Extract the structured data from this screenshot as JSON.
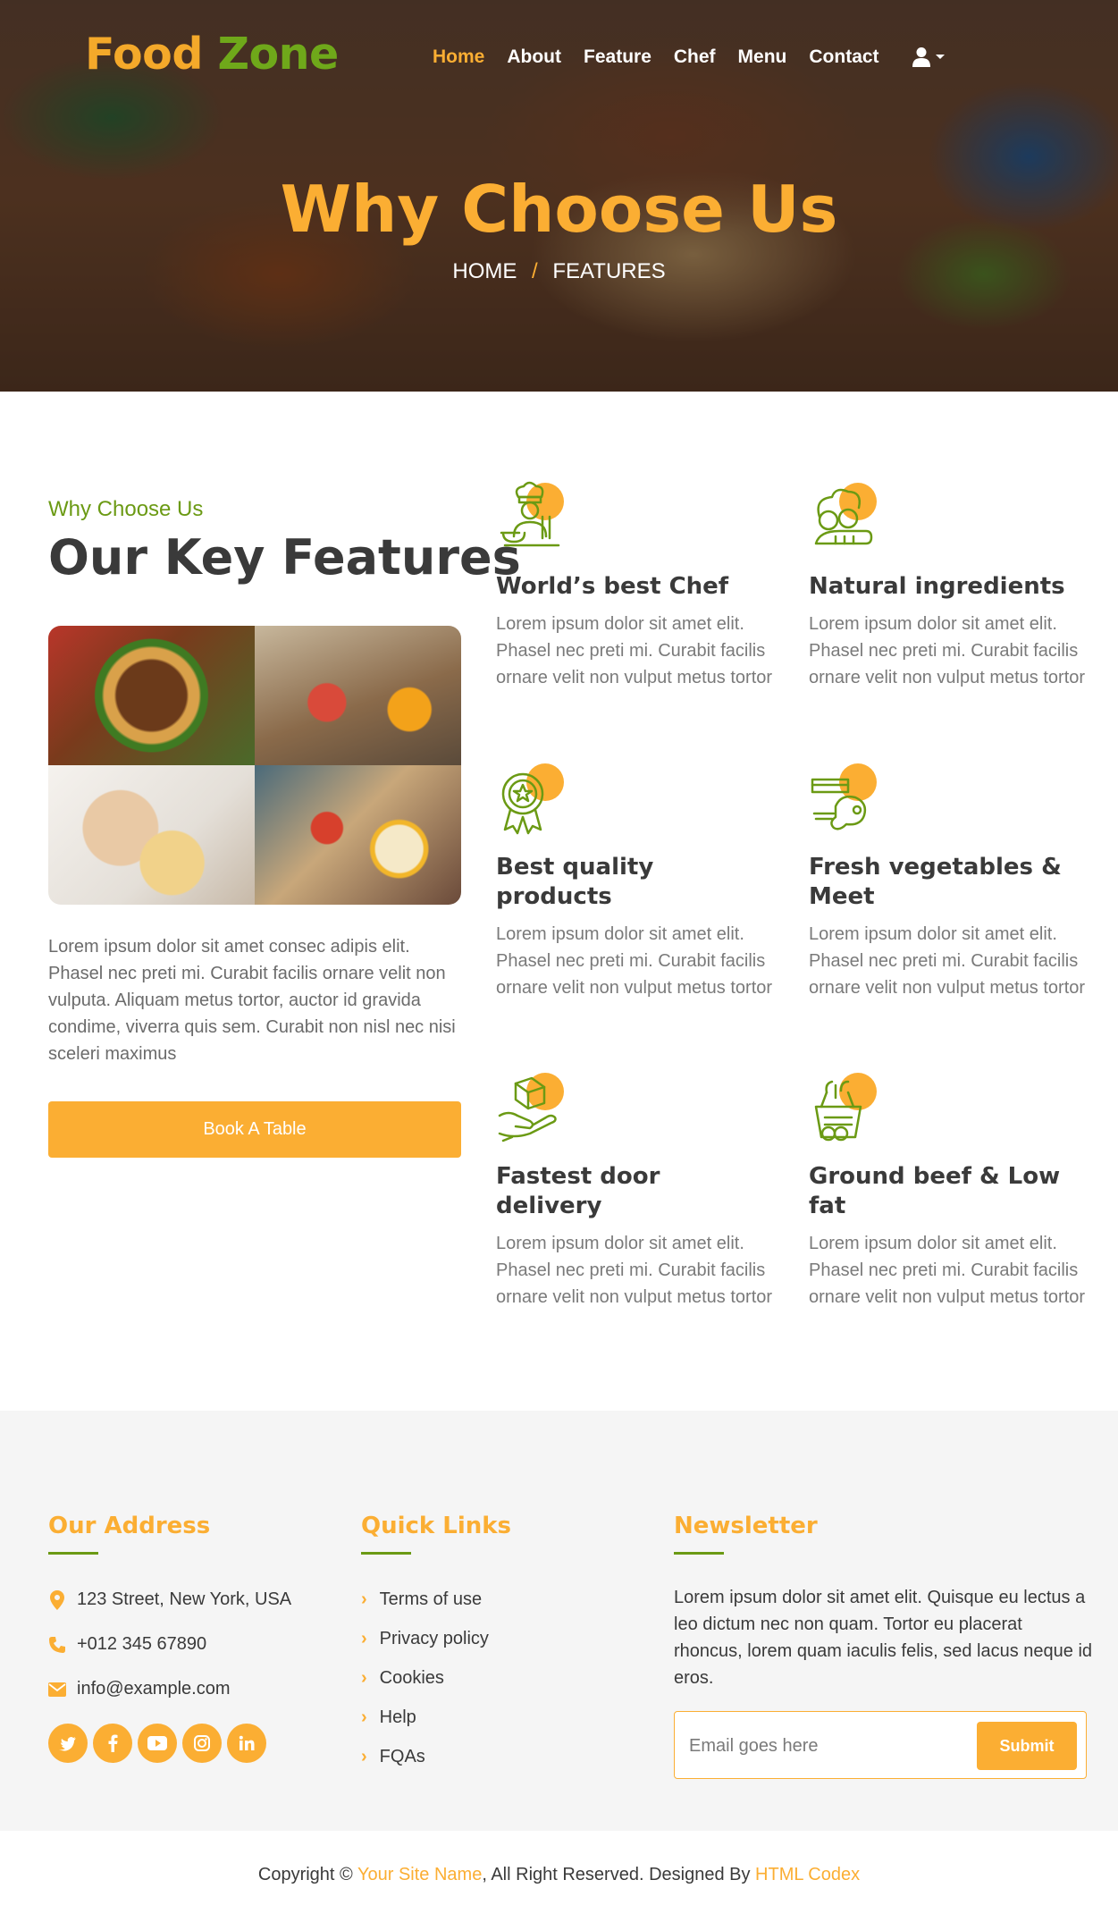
{
  "brand": {
    "part1": "Food",
    "part2": "Zone"
  },
  "nav": {
    "items": [
      {
        "label": "Home",
        "active": true
      },
      {
        "label": "About"
      },
      {
        "label": "Feature"
      },
      {
        "label": "Chef"
      },
      {
        "label": "Menu"
      },
      {
        "label": "Contact"
      }
    ],
    "user_icon": "user-icon"
  },
  "hero": {
    "title": "Why Choose Us",
    "breadcrumb": [
      "HOME",
      "FEATURES"
    ],
    "separator": "/"
  },
  "features": {
    "subtitle": "Why Choose Us",
    "title": "Our Key Features",
    "intro": "Lorem ipsum dolor sit amet consec adipis elit. Phasel nec preti mi. Curabit facilis ornare velit non vulputa. Aliquam metus tortor, auctor id gravida condime, viverra quis sem. Curabit non nisl nec nisi sceleri maximus",
    "button": "Book A Table",
    "items": [
      {
        "title": "World’s best Chef",
        "text": "Lorem ipsum dolor sit amet elit. Phasel nec preti mi. Curabit facilis ornare velit non vulput metus tortor",
        "icon": "chef-icon"
      },
      {
        "title": "Natural ingredients",
        "text": "Lorem ipsum dolor sit amet elit. Phasel nec preti mi. Curabit facilis ornare velit non vulput metus tortor",
        "icon": "vegetables-icon"
      },
      {
        "title": "Best quality products",
        "text": "Lorem ipsum dolor sit amet elit. Phasel nec preti mi. Curabit facilis ornare velit non vulput metus tortor",
        "icon": "quality-badge-icon"
      },
      {
        "title": "Fresh vegetables & Meet",
        "text": "Lorem ipsum dolor sit amet elit. Phasel nec preti mi. Curabit facilis ornare velit non vulput metus tortor",
        "icon": "meat-icon"
      },
      {
        "title": "Fastest door delivery",
        "text": "Lorem ipsum dolor sit amet elit. Phasel nec preti mi. Curabit facilis ornare velit non vulput metus tortor",
        "icon": "delivery-icon"
      },
      {
        "title": "Ground beef & Low fat",
        "text": "Lorem ipsum dolor sit amet elit. Phasel nec preti mi. Curabit facilis ornare velit non vulput metus tortor",
        "icon": "grocery-icon"
      }
    ]
  },
  "footer": {
    "address_title": "Our Address",
    "address": "123 Street, New York, USA",
    "phone": "+012 345 67890",
    "email": "info@example.com",
    "socials": [
      "twitter",
      "facebook",
      "youtube",
      "instagram",
      "linkedin"
    ],
    "links_title": "Quick Links",
    "links": [
      "Terms of use",
      "Privacy policy",
      "Cookies",
      "Help",
      "FQAs"
    ],
    "newsletter_title": "Newsletter",
    "newsletter_text": "Lorem ipsum dolor sit amet elit. Quisque eu lectus a leo dictum nec non quam. Tortor eu placerat rhoncus, lorem quam iaculis felis, sed lacus neque id eros.",
    "email_placeholder": "Email goes here",
    "submit": "Submit"
  },
  "copyright": {
    "prefix": "Copyright © ",
    "site": "Your Site Name",
    "middle": ", All Right Reserved. Designed By ",
    "designer": "HTML Codex"
  },
  "colors": {
    "accent": "#fbae33",
    "green": "#6b9a14",
    "text": "#3a3a3a"
  }
}
